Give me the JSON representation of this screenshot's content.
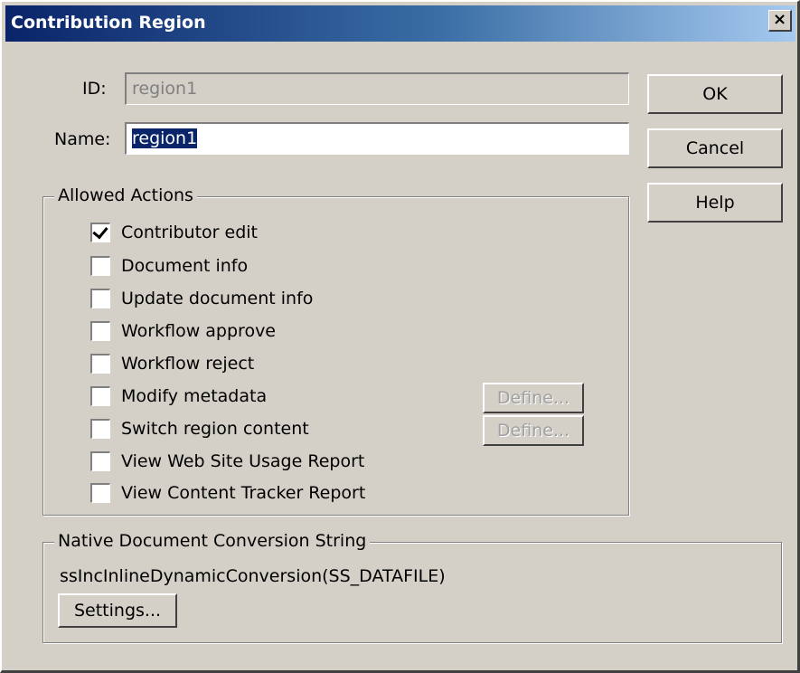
{
  "dialog": {
    "title": "Contribution Region",
    "close_glyph": "×"
  },
  "fields": {
    "id_label": "ID:",
    "id_value": "region1",
    "name_label": "Name:",
    "name_value": "region1"
  },
  "buttons": {
    "ok": "OK",
    "cancel": "Cancel",
    "help": "Help"
  },
  "allowed_actions": {
    "title": "Allowed Actions",
    "items": [
      {
        "label": "Contributor edit",
        "checked": true
      },
      {
        "label": "Document info",
        "checked": false
      },
      {
        "label": "Update document info",
        "checked": false
      },
      {
        "label": "Workflow approve",
        "checked": false
      },
      {
        "label": "Workflow reject",
        "checked": false
      },
      {
        "label": "Modify metadata",
        "checked": false
      },
      {
        "label": "Switch region content",
        "checked": false
      },
      {
        "label": "View Web Site Usage Report",
        "checked": false
      },
      {
        "label": "View Content Tracker Report",
        "checked": false
      }
    ],
    "define_label_1": "Define...",
    "define_label_2": "Define..."
  },
  "conversion": {
    "title": "Native Document Conversion String",
    "value": "ssIncInlineDynamicConversion(SS_DATAFILE)",
    "settings_button": "Settings..."
  }
}
